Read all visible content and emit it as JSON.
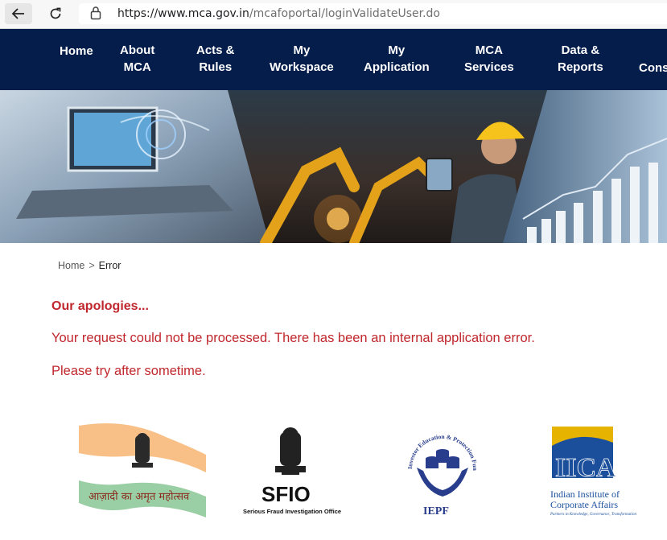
{
  "browser": {
    "url_host": "https://www.mca.gov.in",
    "url_path": "/mcafoportal/loginValidateUser.do"
  },
  "nav": {
    "items": [
      {
        "label": "Home"
      },
      {
        "label": "About\nMCA"
      },
      {
        "label": "Acts &\nRules"
      },
      {
        "label": "My\nWorkspace"
      },
      {
        "label": "My\nApplication"
      },
      {
        "label": "MCA\nServices"
      },
      {
        "label": "Data &\nReports"
      },
      {
        "label": "Cons"
      }
    ]
  },
  "breadcrumb": {
    "home": "Home",
    "separator": ">",
    "current": "Error"
  },
  "error": {
    "title": "Our apologies...",
    "message": "Your request could not be processed. There has been an internal application error.",
    "retry": "Please try after sometime."
  },
  "logos": {
    "azadi_text": "आज़ादी का अमृत महोत्सव",
    "sfio_title": "SFIO",
    "sfio_subtitle": "Serious Fraud Investigation Office",
    "iepf_title": "IEPF",
    "iepf_ring": "Investor Education & Protection Fund Authority",
    "iica_title": "IICA",
    "iica_line1": "Indian Institute of",
    "iica_line2": "Corporate Affairs",
    "iica_tagline": "Partners in Knowledge, Governance, Transformation"
  },
  "colors": {
    "nav_bg": "#041d4a",
    "error_red": "#c0272d",
    "iica_blue": "#1b4f9c",
    "iica_gold": "#e5b300"
  }
}
